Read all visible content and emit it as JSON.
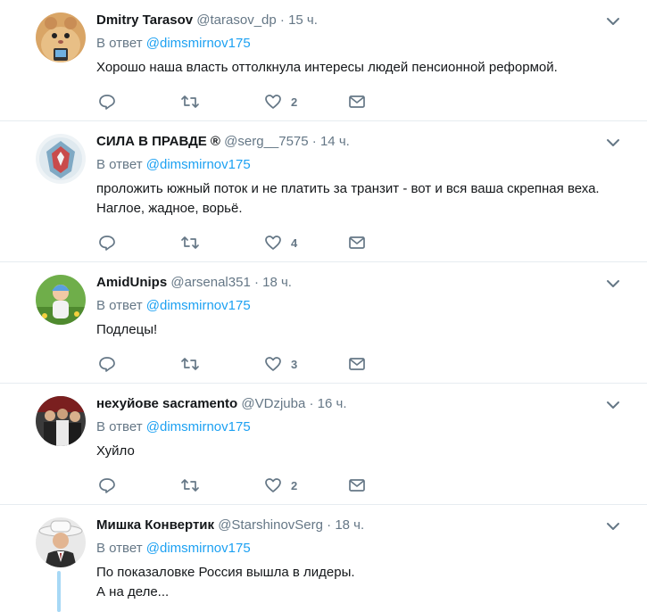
{
  "reply_prefix": "В ответ",
  "tweets": [
    {
      "name": "Dmitry Tarasov",
      "handle": "@tarasov_dp",
      "time": "15 ч.",
      "mention": "@dimsmirnov175",
      "text": "Хорошо наша власть оттолкнула интересы людей пенсионной реформой.",
      "likes": "2"
    },
    {
      "name": "СИЛА В ПРАВДЕ ®",
      "handle": "@serg__7575",
      "time": "14 ч.",
      "mention": "@dimsmirnov175",
      "text": "проложить южный поток и не платить за транзит - вот и вся ваша скрепная веха. Наглое, жадное, ворьё.",
      "likes": "4"
    },
    {
      "name": "AmidUnips",
      "handle": "@arsenal351",
      "time": "18 ч.",
      "mention": "@dimsmirnov175",
      "text": "Подлецы!",
      "likes": "3"
    },
    {
      "name": "нехуйове sacramento",
      "handle": "@VDzjuba",
      "time": "16 ч.",
      "mention": "@dimsmirnov175",
      "text": "Хуйло",
      "likes": "2"
    },
    {
      "name": "Мишка Конвертик",
      "handle": "@StarshinovSerg",
      "time": "18 ч.",
      "mention": "@dimsmirnov175",
      "text_line1": "По показаловке Россия вышла в лидеры.",
      "text_line2": "А на деле..."
    }
  ],
  "separator": "·",
  "colors": {
    "accent": "#1da1f2",
    "muted": "#657786",
    "text": "#14171a",
    "border": "#e6ecf0"
  }
}
